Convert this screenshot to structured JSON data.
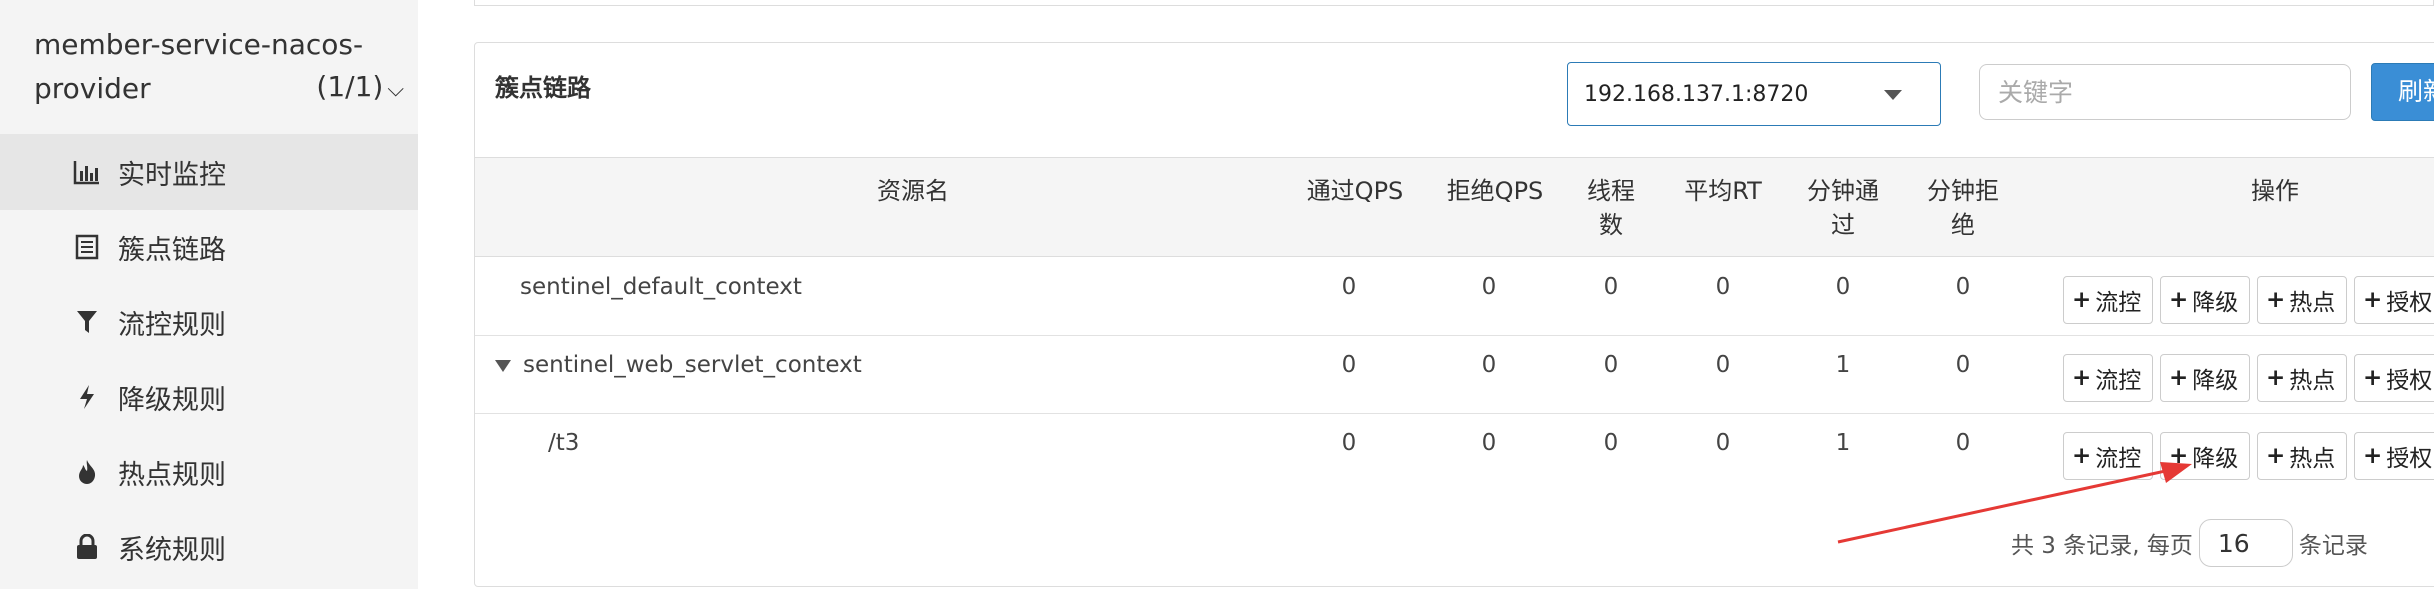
{
  "app": {
    "title_line1": "member-service-nacos-",
    "title_line2": "provider",
    "count": "(1/1)"
  },
  "sidebar": {
    "items": [
      {
        "label": "实时监控",
        "icon": "bar-chart-icon"
      },
      {
        "label": "簇点链路",
        "icon": "list-icon"
      },
      {
        "label": "流控规则",
        "icon": "filter-icon"
      },
      {
        "label": "降级规则",
        "icon": "flash-icon"
      },
      {
        "label": "热点规则",
        "icon": "fire-icon"
      },
      {
        "label": "系统规则",
        "icon": "lock-icon"
      }
    ]
  },
  "panel": {
    "title": "簇点链路",
    "machine": "192.168.137.1:8720",
    "search_placeholder": "关键字",
    "refresh_label": "刷新"
  },
  "table": {
    "headers": {
      "resource": "资源名",
      "pass_qps": "通过QPS",
      "block_qps": "拒绝QPS",
      "threads_1": "线程",
      "threads_2": "数",
      "avg_rt": "平均RT",
      "min_pass_1": "分钟通",
      "min_pass_2": "过",
      "min_block_1": "分钟拒",
      "min_block_2": "绝",
      "ops": "操作"
    },
    "rows": [
      {
        "resource": "sentinel_default_context",
        "pass_qps": "0",
        "block_qps": "0",
        "threads": "0",
        "avg_rt": "0",
        "min_pass": "0",
        "min_block": "0"
      },
      {
        "resource": "sentinel_web_servlet_context",
        "pass_qps": "0",
        "block_qps": "0",
        "threads": "0",
        "avg_rt": "0",
        "min_pass": "1",
        "min_block": "0"
      },
      {
        "resource": "/t3",
        "pass_qps": "0",
        "block_qps": "0",
        "threads": "0",
        "avg_rt": "0",
        "min_pass": "1",
        "min_block": "0"
      }
    ],
    "actions": {
      "flow": "流控",
      "degrade": "降级",
      "hotspot": "热点",
      "auth": "授权"
    }
  },
  "pagination": {
    "total_text": "共 3 条记录, 每页",
    "page_size": "16",
    "suffix": "条记录"
  },
  "colors": {
    "primary": "#3a8ed6",
    "select_border": "#2c7bb6",
    "arrow": "#e53935",
    "sidebar_bg": "#f4f4f4"
  }
}
